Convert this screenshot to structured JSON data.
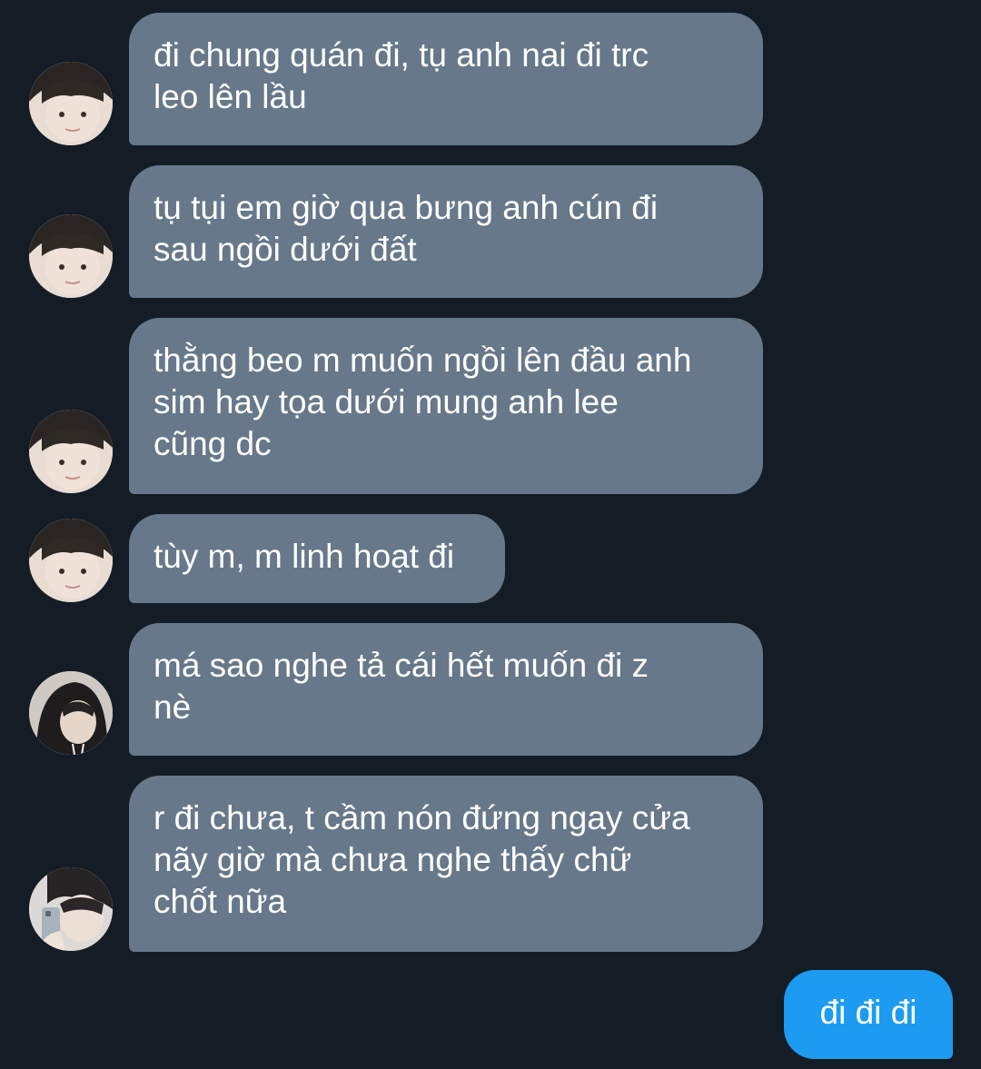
{
  "conversation": {
    "messages": [
      {
        "sender_avatar": "avatar-boy-face-icon",
        "text": "đi chung quán đi, tụ anh nai đi trc\nleo lên lầu"
      },
      {
        "sender_avatar": "avatar-boy-face-icon",
        "text": "tụ tụi em giờ qua bưng anh cún đi\nsau ngồi dưới đất"
      },
      {
        "sender_avatar": "avatar-boy-face-icon",
        "text": "thằng beo m muốn ngồi lên đầu anh\nsim hay tọa dưới mung anh lee\ncũng dc"
      },
      {
        "sender_avatar": "avatar-boy-face-icon",
        "text": "tùy m, m linh hoạt đi"
      },
      {
        "sender_avatar": "avatar-hoodie-icon",
        "text": "má sao nghe tả cái hết muốn đi z\nnè"
      },
      {
        "sender_avatar": "avatar-selfie-icon",
        "text": "r đi chưa, t cầm nón đứng ngay cửa\nnãy giờ mà chưa nghe thấy chữ\nchốt nữa"
      }
    ],
    "outgoing": {
      "text": "đi đi đi"
    }
  },
  "colors": {
    "background": "#141d26",
    "incoming_bubble": "#66788a",
    "outgoing_bubble": "#1d9bf0",
    "text": "#ffffff"
  }
}
